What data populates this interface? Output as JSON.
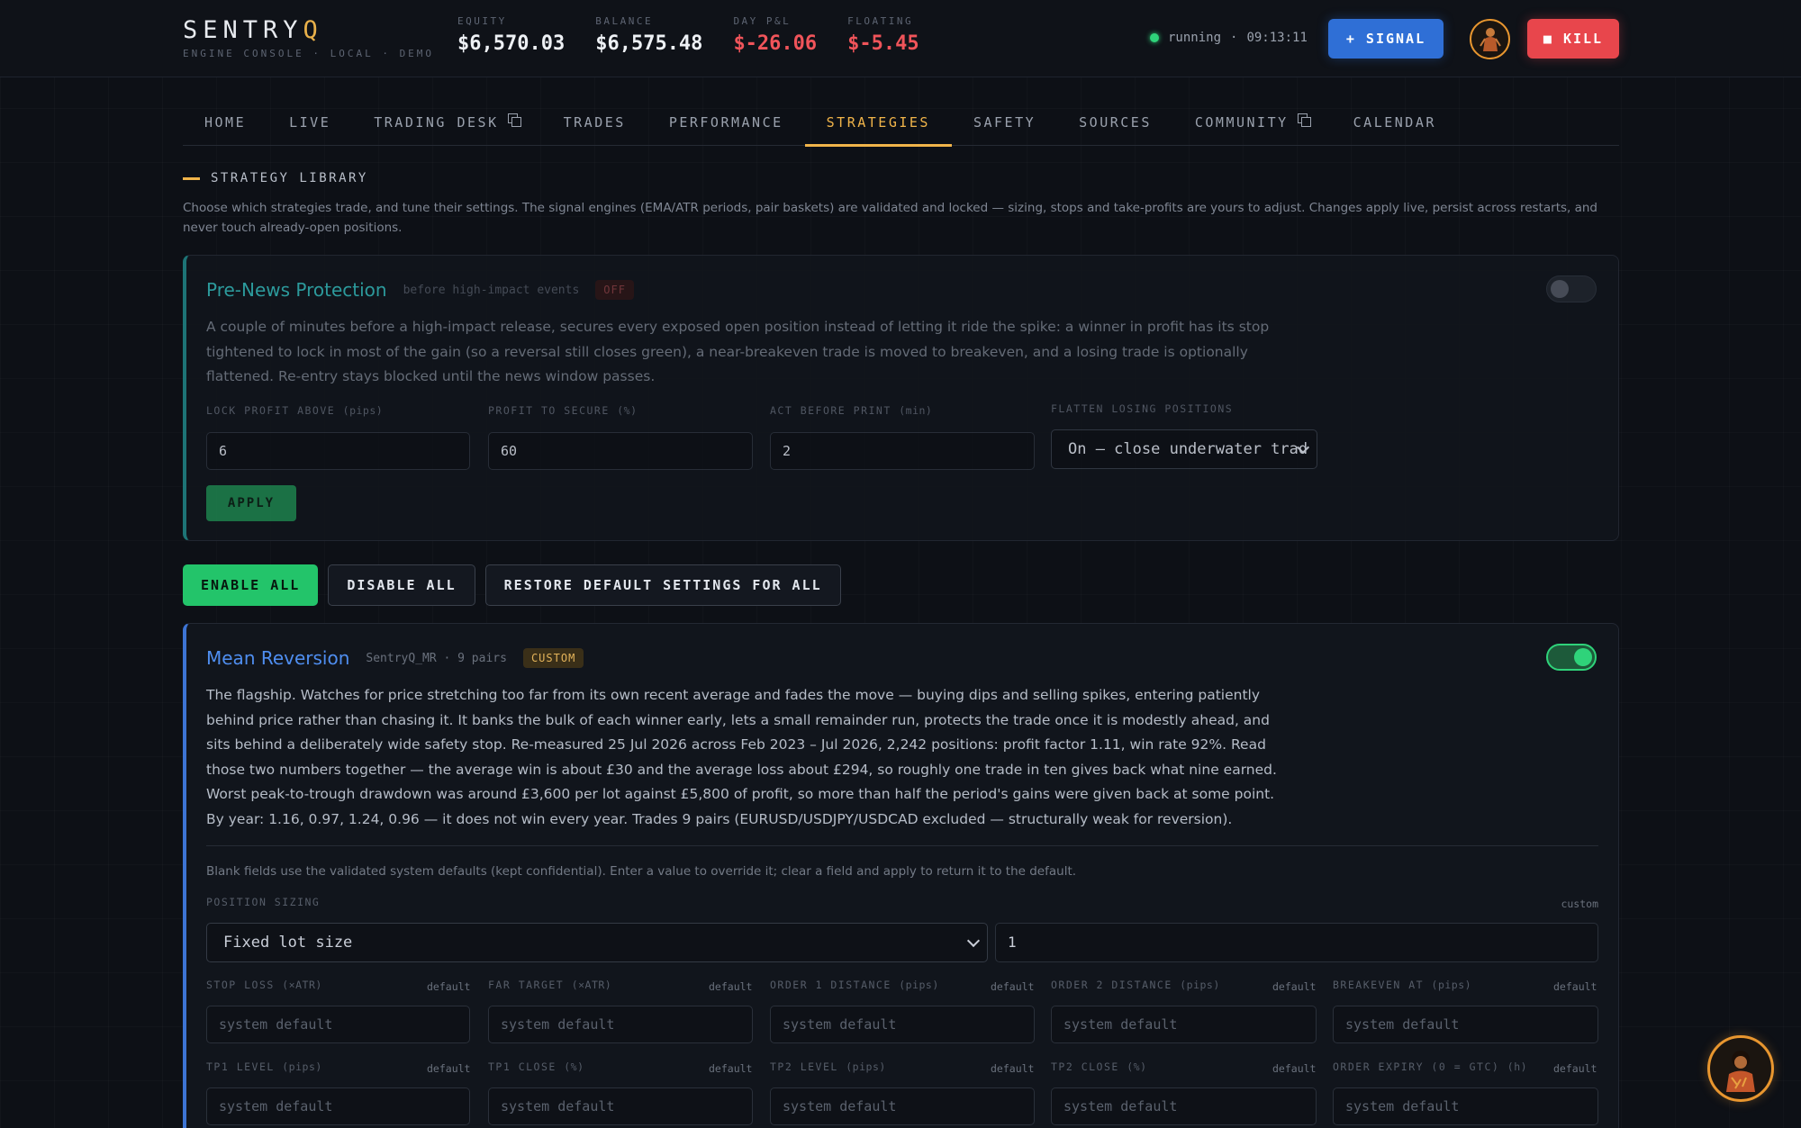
{
  "brand": {
    "name_main": "SENTRY",
    "name_accent": "Q",
    "subtitle": "ENGINE CONSOLE · LOCAL · DEMO"
  },
  "stats": [
    {
      "label": "EQUITY",
      "value": "$6,570.03",
      "negative": false
    },
    {
      "label": "BALANCE",
      "value": "$6,575.48",
      "negative": false
    },
    {
      "label": "DAY P&L",
      "value": "$-26.06",
      "negative": true
    },
    {
      "label": "FLOATING",
      "value": "$-5.45",
      "negative": true
    }
  ],
  "status": {
    "state": "running",
    "sep": "·",
    "time": "09:13:11"
  },
  "header_buttons": {
    "signal": "+ SIGNAL",
    "kill": "■ KILL"
  },
  "nav": [
    {
      "label": "HOME",
      "external": false,
      "active": false
    },
    {
      "label": "LIVE",
      "external": false,
      "active": false
    },
    {
      "label": "TRADING DESK",
      "external": true,
      "active": false
    },
    {
      "label": "TRADES",
      "external": false,
      "active": false
    },
    {
      "label": "PERFORMANCE",
      "external": false,
      "active": false
    },
    {
      "label": "STRATEGIES",
      "external": false,
      "active": true
    },
    {
      "label": "SAFETY",
      "external": false,
      "active": false
    },
    {
      "label": "SOURCES",
      "external": false,
      "active": false
    },
    {
      "label": "COMMUNITY",
      "external": true,
      "active": false
    },
    {
      "label": "CALENDAR",
      "external": false,
      "active": false
    }
  ],
  "library": {
    "title": "STRATEGY LIBRARY",
    "description": "Choose which strategies trade, and tune their settings. The signal engines (EMA/ATR periods, pair baskets) are validated and locked — sizing, stops and take-profits are yours to adjust. Changes apply live, persist across restarts, and never touch already-open positions."
  },
  "pre_news": {
    "title": "Pre-News Protection",
    "meta": "before high-impact events",
    "badge": "OFF",
    "enabled": false,
    "description": "A couple of minutes before a high-impact release, secures every exposed open position instead of letting it ride the spike: a winner in profit has its stop tightened to lock in most of the gain (so a reversal still closes green), a near-breakeven trade is moved to breakeven, and a losing trade is optionally flattened. Re-entry stays blocked until the news window passes.",
    "fields": [
      {
        "label": "LOCK PROFIT ABOVE",
        "unit": "(pips)",
        "value": "6"
      },
      {
        "label": "PROFIT TO SECURE",
        "unit": "(%)",
        "value": "60"
      },
      {
        "label": "ACT BEFORE PRINT",
        "unit": "(min)",
        "value": "2"
      }
    ],
    "flatten": {
      "label": "FLATTEN LOSING POSITIONS",
      "value": "On — close underwater trad"
    },
    "apply": "APPLY"
  },
  "bulk": {
    "enable_all": "ENABLE ALL",
    "disable_all": "DISABLE ALL",
    "restore": "RESTORE DEFAULT SETTINGS FOR ALL"
  },
  "mean_reversion": {
    "title": "Mean Reversion",
    "meta": "SentryQ_MR · 9 pairs",
    "badge": "CUSTOM",
    "enabled": true,
    "description": "The flagship. Watches for price stretching too far from its own recent average and fades the move — buying dips and selling spikes, entering patiently behind price rather than chasing it. It banks the bulk of each winner early, lets a small remainder run, protects the trade once it is modestly ahead, and sits behind a deliberately wide safety stop. Re-measured 25 Jul 2026 across Feb 2023 – Jul 2026, 2,242 positions: profit factor 1.11, win rate 92%. Read those two numbers together — the average win is about £30 and the average loss about £294, so roughly one trade in ten gives back what nine earned. Worst peak-to-trough drawdown was around £3,600 per lot against £5,800 of profit, so more than half the period's gains were given back at some point. By year: 1.16, 0.97, 1.24, 0.96 — it does not win every year. Trades 9 pairs (EURUSD/USDJPY/USDCAD excluded — structurally weak for reversion).",
    "hint": "Blank fields use the validated system defaults (kept confidential). Enter a value to override it; clear a field and apply to return it to the default.",
    "sizing": {
      "label": "POSITION SIZING",
      "tag": "custom",
      "mode": "Fixed lot size",
      "value": "1"
    },
    "placeholder": "system default",
    "default_tag": "default",
    "row1": [
      {
        "label": "STOP LOSS",
        "unit": "(×ATR)"
      },
      {
        "label": "FAR TARGET",
        "unit": "(×ATR)"
      },
      {
        "label": "ORDER 1 DISTANCE",
        "unit": "(pips)"
      },
      {
        "label": "ORDER 2 DISTANCE",
        "unit": "(pips)"
      },
      {
        "label": "BREAKEVEN AT",
        "unit": "(pips)"
      }
    ],
    "row2": [
      {
        "label": "TP1 LEVEL",
        "unit": "(pips)"
      },
      {
        "label": "TP1 CLOSE",
        "unit": "(%)"
      },
      {
        "label": "TP2 LEVEL",
        "unit": "(pips)"
      },
      {
        "label": "TP2 CLOSE",
        "unit": "(%)"
      },
      {
        "label": "ORDER EXPIRY (0 = GTC)",
        "unit": "(h)"
      }
    ]
  },
  "colors": {
    "accent": "#f0b44a",
    "positive": "#2fd37a",
    "negative": "#f0545a",
    "signal": "#2f6fd6",
    "kill": "#e8464c"
  },
  "icons": {
    "avatar": "trader-avatar-icon",
    "external": "external-window-icon"
  }
}
